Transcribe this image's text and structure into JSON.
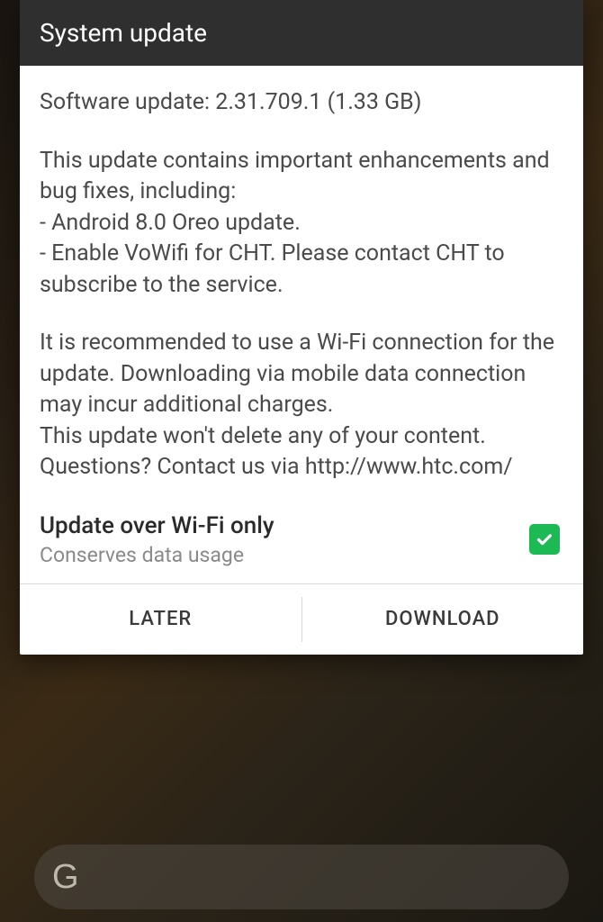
{
  "header": {
    "title": "System update"
  },
  "body": {
    "update_line": "Software update: 2.31.709.1 (1.33 GB)",
    "intro": "This update contains important enhancements and bug fixes, including:",
    "bullet1": "- Android 8.0 Oreo update.",
    "bullet2": "- Enable VoWifi for CHT. Please contact CHT to subscribe to the service.",
    "recommend": "It is recommended to use a Wi-Fi connection for the update. Downloading via mobile data connection may incur additional charges.",
    "nodelete": "This update won't delete any of your content. Questions? Contact us via http://www.htc.com/"
  },
  "wifi_option": {
    "title": "Update over Wi-Fi only",
    "subtitle": "Conserves data usage",
    "checked": true
  },
  "actions": {
    "later": "LATER",
    "download": "DOWNLOAD"
  },
  "search": {
    "logo": "G"
  }
}
